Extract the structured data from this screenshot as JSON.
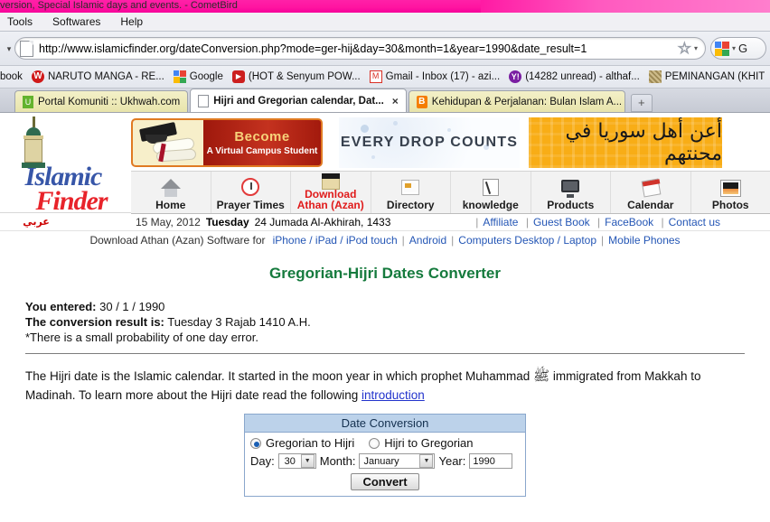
{
  "window": {
    "title": "version, Special Islamic days and events. - CometBird"
  },
  "menubar": {
    "items": [
      "Tools",
      "Softwares",
      "Help"
    ]
  },
  "urlbar": {
    "url": "http://www.islamicfinder.org/dateConversion.php?mode=ger-hij&day=30&month=1&year=1990&date_result=1",
    "search_engine_label": "G"
  },
  "bookmarks": [
    {
      "label": "book",
      "icon": "none"
    },
    {
      "label": "NARUTO MANGA - RE...",
      "icon": "w-circle-icon"
    },
    {
      "label": "Google",
      "icon": "google-icon"
    },
    {
      "label": "(HOT & Senyum POW...",
      "icon": "youtube-icon"
    },
    {
      "label": "Gmail - Inbox (17) - azi...",
      "icon": "gmail-icon"
    },
    {
      "label": "(14282 unread) - althaf...",
      "icon": "yahoo-icon"
    },
    {
      "label": "PEMINANGAN (KHIT",
      "icon": "image-icon"
    }
  ],
  "tabs": [
    {
      "label": "Portal Komuniti :: Ukhwah.com",
      "active": false,
      "icon": "ukhwah-icon"
    },
    {
      "label": "Hijri and Gregorian calendar, Dat...",
      "active": true,
      "icon": "page-icon",
      "close": "×"
    },
    {
      "label": "Kehidupan & Perjalanan: Bulan Islam A...",
      "active": false,
      "icon": "blogger-icon"
    }
  ],
  "new_tab_label": "+",
  "site": {
    "logo": {
      "line1": "Islamic",
      "line2": "Finder"
    },
    "ads": {
      "campus": {
        "line1": "Become",
        "line2": "A Virtual Campus Student"
      },
      "drop": {
        "text": "EVERY DROP COUNTS"
      },
      "arabic": {
        "text": "أعن أهل سوريا في محنتهم"
      }
    },
    "nav": [
      {
        "label": "Home",
        "icon": "home-icon",
        "red": false
      },
      {
        "label": "Prayer Times",
        "icon": "clock-icon",
        "red": false
      },
      {
        "label": "Download\nAthan (Azan)",
        "line1": "Download",
        "line2": "Athan (Azan)",
        "icon": "kaaba-icon",
        "red": true
      },
      {
        "label": "Directory",
        "icon": "directory-icon",
        "red": false
      },
      {
        "label": "knowledge",
        "icon": "notebook-pen-icon",
        "red": false
      },
      {
        "label": "Products",
        "icon": "monitor-icon",
        "red": false
      },
      {
        "label": "Calendar",
        "icon": "calendar-icon",
        "red": false
      },
      {
        "label": "Photos",
        "icon": "photo-icon",
        "red": false
      }
    ],
    "infobar": {
      "arabic_link": "عربي",
      "gregorian_date": "15 May, 2012",
      "weekday": "Tuesday",
      "hijri_date": "24 Jumada Al-Akhirah, 1433",
      "links": [
        "Affiliate",
        "Guest Book",
        "FaceBook",
        "Contact us"
      ],
      "download_prefix": "Download Athan (Azan) Software for",
      "download_links": [
        "iPhone / iPad / iPod touch",
        "Android",
        "Computers Desktop / Laptop",
        "Mobile Phones"
      ]
    }
  },
  "main": {
    "title": "Gregorian-Hijri Dates Converter",
    "entered_label": "You entered:",
    "entered_value": "30 / 1 / 1990",
    "result_label": "The conversion result is:",
    "result_value": "Tuesday 3 Rajab 1410 A.H.",
    "note": "*There is a small probability of one day error.",
    "description_part1": "The Hijri date is the Islamic calendar. It started in the moon year in which prophet Muhammad ",
    "saw_symbol": "ﷺ",
    "description_part2": " immigrated from Makkah to Madinah. To learn more about the Hijri date read the following ",
    "introduction_link": "introduction"
  },
  "form": {
    "header": "Date Conversion",
    "radio_gregorian": "Gregorian to Hijri",
    "radio_hijri": "Hijri to Gregorian",
    "selected": "gregorian",
    "day_label": "Day:",
    "day_value": "30",
    "month_label": "Month:",
    "month_value": "January",
    "year_label": "Year:",
    "year_value": "1990",
    "convert_label": "Convert",
    "dropdown_arrow": "▼"
  },
  "colors": {
    "title_green": "#157a3d",
    "link_blue": "#2456b5",
    "accent_pink": "#ff14a0",
    "nav_red": "#e01b1b",
    "form_header_blue": "#bcd2ea"
  }
}
